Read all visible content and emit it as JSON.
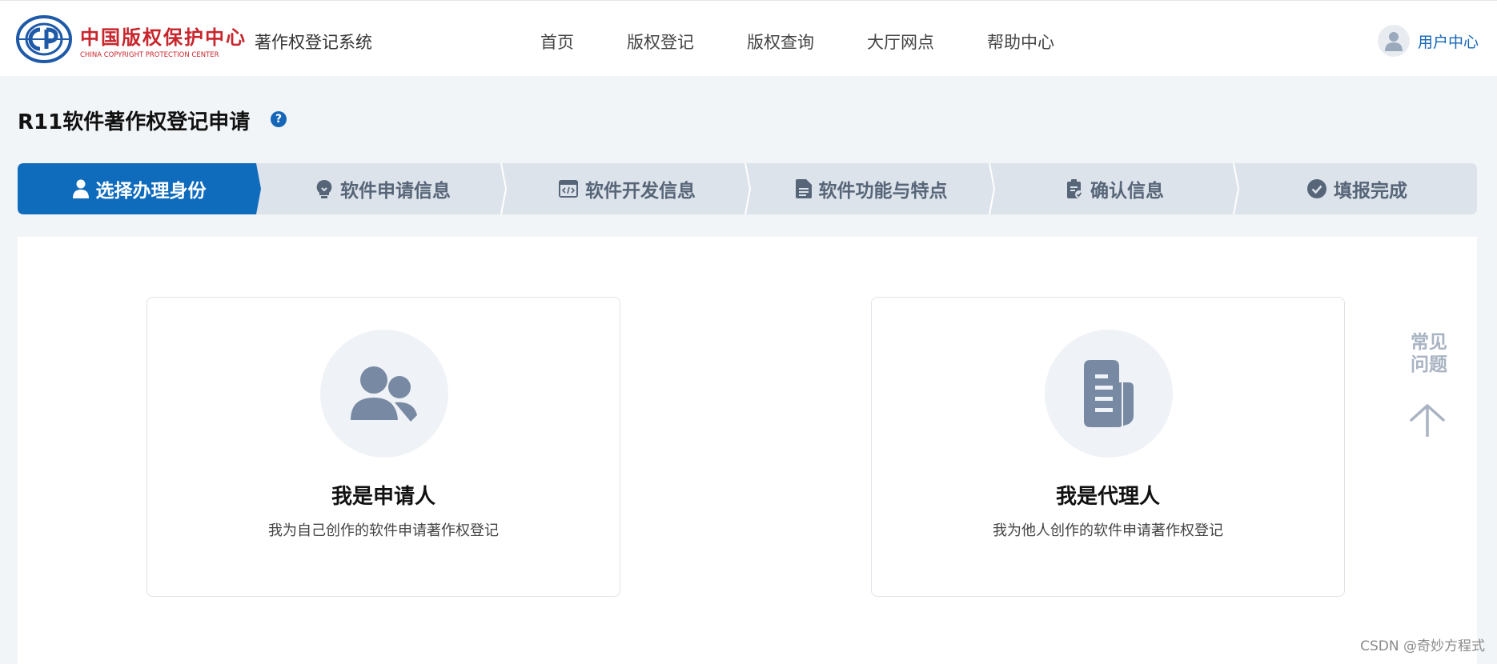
{
  "header": {
    "logo_cn": "中国版权保护中心",
    "logo_en": "CHINA COPYRIGHT PROTECTION CENTER",
    "system_name": "著作权登记系统",
    "nav": [
      "首页",
      "版权登记",
      "版权查询",
      "大厅网点",
      "帮助中心"
    ],
    "user_center": "用户中心"
  },
  "page": {
    "title": "R11软件著作权登记申请",
    "help": "?"
  },
  "steps": {
    "active_index": 0,
    "items": [
      {
        "label": "选择办理身份",
        "icon": "person-icon"
      },
      {
        "label": "软件申请信息",
        "icon": "lightbulb-icon"
      },
      {
        "label": "软件开发信息",
        "icon": "code-window-icon"
      },
      {
        "label": "软件功能与特点",
        "icon": "document-icon"
      },
      {
        "label": "确认信息",
        "icon": "clipboard-check-icon"
      },
      {
        "label": "填报完成",
        "icon": "check-circle-icon"
      }
    ]
  },
  "cards": [
    {
      "title": "我是申请人",
      "desc": "我为自己创作的软件申请著作权登记",
      "icon": "users-icon"
    },
    {
      "title": "我是代理人",
      "desc": "我为他人创作的软件申请著作权登记",
      "icon": "document-icon"
    }
  ],
  "sidebar": {
    "faq_line1": "常见",
    "faq_line2": "问题",
    "back_to_top": "arrow-up-icon"
  },
  "watermark": "CSDN @奇妙方程式",
  "colors": {
    "primary": "#1566b8",
    "step_active": "#0f6cbd",
    "step_inactive": "#dde3ea",
    "logo_red": "#c8252c"
  }
}
